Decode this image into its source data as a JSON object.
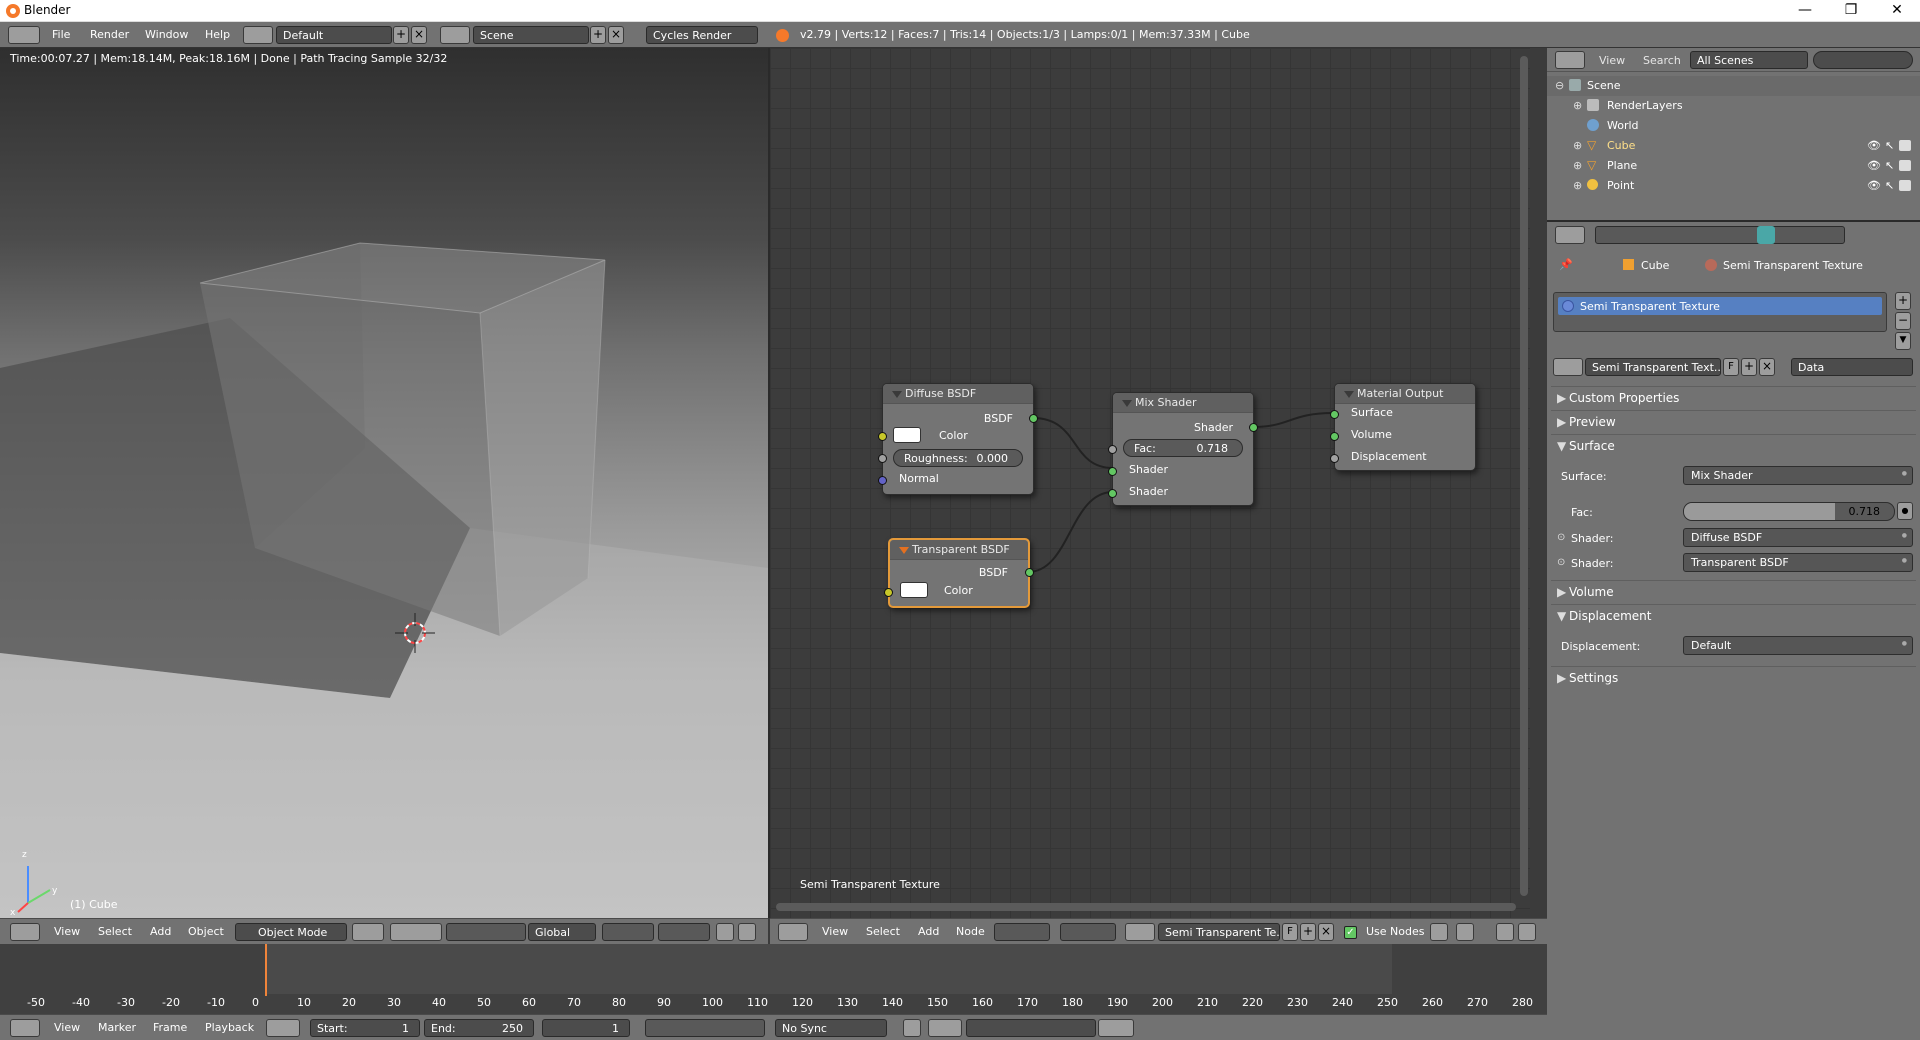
{
  "window": {
    "title": "Blender",
    "minimize": "—",
    "maximize": "❐",
    "close": "✕"
  },
  "info_header": {
    "menus": [
      "File",
      "Render",
      "Window",
      "Help"
    ],
    "screen_layout": "Default",
    "scene": "Scene",
    "render_engine": "Cycles Render",
    "stats": "v2.79 | Verts:12 | Faces:7 | Tris:14 | Objects:1/3 | Lamps:0/1 | Mem:37.33M | Cube"
  },
  "viewport": {
    "render_status": "Time:00:07.27 | Mem:18.14M, Peak:18.16M | Done | Path Tracing Sample 32/32",
    "object_label": "(1) Cube",
    "axis_labels": {
      "x": "x",
      "y": "y",
      "z": "z"
    }
  },
  "viewport_header": {
    "menus": [
      "View",
      "Select",
      "Add",
      "Object"
    ],
    "mode": "Object Mode",
    "orientation": "Global"
  },
  "node_editor": {
    "material_label": "Semi Transparent Texture",
    "nodes": {
      "diffuse": {
        "title": "Diffuse BSDF",
        "output": "BSDF",
        "color_label": "Color",
        "roughness_label": "Roughness:",
        "roughness_value": "0.000",
        "normal_label": "Normal"
      },
      "transparent": {
        "title": "Transparent BSDF",
        "output": "BSDF",
        "color_label": "Color"
      },
      "mix": {
        "title": "Mix Shader",
        "output": "Shader",
        "fac_label": "Fac:",
        "fac_value": "0.718",
        "shader1": "Shader",
        "shader2": "Shader"
      },
      "output": {
        "title": "Material Output",
        "surface": "Surface",
        "volume": "Volume",
        "displacement": "Displacement"
      }
    }
  },
  "node_header": {
    "menus": [
      "View",
      "Select",
      "Add",
      "Node"
    ],
    "material_field": "Semi Transparent Te...",
    "fake_user": "F",
    "use_nodes_label": "Use Nodes",
    "use_nodes_checked": true
  },
  "outliner": {
    "menus": [
      "View",
      "Search"
    ],
    "display_mode": "All Scenes",
    "items": [
      {
        "label": "Scene",
        "icon": "scene-icon"
      },
      {
        "label": "RenderLayers",
        "icon": "renderlayers-icon"
      },
      {
        "label": "World",
        "icon": "world-icon"
      },
      {
        "label": "Cube",
        "icon": "mesh-icon"
      },
      {
        "label": "Plane",
        "icon": "mesh-icon"
      },
      {
        "label": "Point",
        "icon": "lamp-icon"
      }
    ]
  },
  "properties": {
    "breadcrumb": {
      "object": "Cube",
      "material": "Semi Transparent Texture"
    },
    "slot_item": "Semi Transparent Texture",
    "material_field": "Semi Transparent Text...",
    "fake_user": "F",
    "link_mode": "Data",
    "panels": {
      "custom_properties": "Custom Properties",
      "preview": "Preview",
      "surface": "Surface",
      "volume": "Volume",
      "displacement": "Displacement",
      "settings": "Settings"
    },
    "surface_rows": {
      "surface_label": "Surface:",
      "surface_value": "Mix Shader",
      "fac_label": "Fac:",
      "fac_value": "0.718",
      "fac_fraction": 0.718,
      "shader1_label": "Shader:",
      "shader1_value": "Diffuse BSDF",
      "shader2_label": "Shader:",
      "shader2_value": "Transparent BSDF"
    },
    "displacement_rows": {
      "label": "Displacement:",
      "value": "Default"
    }
  },
  "timeline": {
    "ticks": [
      "-50",
      "-40",
      "-30",
      "-20",
      "-10",
      "0",
      "10",
      "20",
      "30",
      "40",
      "50",
      "60",
      "70",
      "80",
      "90",
      "100",
      "110",
      "120",
      "130",
      "140",
      "150",
      "160",
      "170",
      "180",
      "190",
      "200",
      "210",
      "220",
      "230",
      "240",
      "250",
      "260",
      "270",
      "280"
    ],
    "current_frame": 1,
    "menus": [
      "View",
      "Marker",
      "Frame",
      "Playback"
    ],
    "start_label": "Start:",
    "start_value": "1",
    "end_label": "End:",
    "end_value": "250",
    "frame_value": "1",
    "sync": "No Sync"
  },
  "colors": {
    "accent_blue": "#5680c2",
    "active_node_border": "#e49a3a",
    "socket_green": "#63c763",
    "socket_yellow": "#c7c729"
  }
}
